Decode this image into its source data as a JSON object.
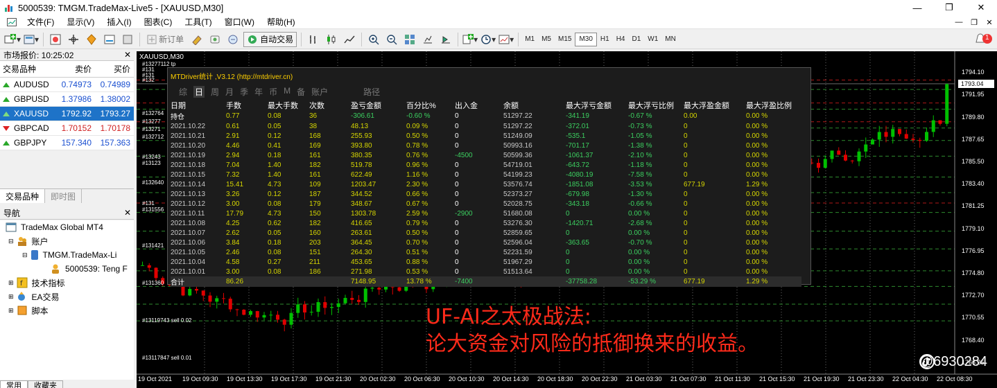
{
  "window": {
    "title": "5000539: TMGM.TradeMax-Live5 - [XAUUSD,M30]"
  },
  "menu": [
    "文件(F)",
    "显示(V)",
    "插入(I)",
    "图表(C)",
    "工具(T)",
    "窗口(W)",
    "帮助(H)"
  ],
  "toolbar": {
    "new_order": "新订单",
    "auto_trade": "自动交易",
    "timeframes": [
      "M1",
      "M5",
      "M15",
      "M30",
      "H1",
      "H4",
      "D1",
      "W1",
      "MN"
    ],
    "active_timeframe": "M30",
    "notification_count": "1"
  },
  "market_watch": {
    "title": "市场报价: 10:25:02",
    "headers": {
      "symbol": "交易品种",
      "bid": "卖价",
      "ask": "买价"
    },
    "rows": [
      {
        "symbol": "AUDUSD",
        "bid": "0.74973",
        "ask": "0.74989",
        "dir": "up",
        "color": "#1a4fd0"
      },
      {
        "symbol": "GBPUSD",
        "bid": "1.37986",
        "ask": "1.38002",
        "dir": "up",
        "color": "#1a4fd0"
      },
      {
        "symbol": "XAUUSD",
        "bid": "1792.92",
        "ask": "1793.27",
        "dir": "up",
        "selected": true
      },
      {
        "symbol": "GBPCAD",
        "bid": "1.70152",
        "ask": "1.70178",
        "dir": "down",
        "color": "#d02020"
      },
      {
        "symbol": "GBPJPY",
        "bid": "157.340",
        "ask": "157.363",
        "dir": "up",
        "color": "#1a4fd0"
      }
    ],
    "tabs": [
      "交易品种",
      "即时图"
    ]
  },
  "navigator": {
    "title": "导航",
    "items": {
      "root": "TradeMax Global MT4",
      "accounts": "账户",
      "server": "TMGM.TradeMax-Li",
      "account": "5000539: Teng F",
      "indicators": "技术指标",
      "ea": "EA交易",
      "scripts": "脚本"
    },
    "tabs": [
      "常用",
      "收藏夹"
    ]
  },
  "chart": {
    "symbol": "XAUUSD,M30",
    "order_labels": [
      "#13277112 tp",
      "#131",
      "#131",
      "#132",
      "#132764",
      "#13277",
      "#13271",
      "#132712",
      "#13243",
      "#13123",
      "#132640",
      "#131",
      "#131556",
      "#131421",
      "#131360",
      "#13119743 sell 0.02",
      "#13117847 sell 0.01"
    ],
    "price_axis": [
      "1794.10",
      "1791.95",
      "1789.80",
      "1787.65",
      "1785.50",
      "1783.40",
      "1781.25",
      "1779.10",
      "1776.95",
      "1774.80",
      "1772.70",
      "1770.55",
      "1768.40",
      "1766.25"
    ],
    "current_price": "1793.04",
    "time_axis": [
      "19 Oct 2021",
      "19 Oct 09:30",
      "19 Oct 13:30",
      "19 Oct 17:30",
      "19 Oct 21:30",
      "20 Oct 02:30",
      "20 Oct 06:30",
      "20 Oct 10:30",
      "20 Oct 14:30",
      "20 Oct 18:30",
      "20 Oct 22:30",
      "21 Oct 03:30",
      "21 Oct 07:30",
      "21 Oct 11:30",
      "21 Oct 15:30",
      "21 Oct 19:30",
      "21 Oct 23:30",
      "22 Oct 04:30",
      "22 Oct 08:30"
    ],
    "candle_colors": {
      "bull": "#00c000",
      "bear": "#e00000"
    }
  },
  "stats": {
    "title": "MTDriver统计 ,V3.12 (http://mtdriver.cn)",
    "tabs": [
      "综",
      "日",
      "周",
      "月",
      "季",
      "年",
      "币",
      "M",
      "备",
      "账户",
      "路径"
    ],
    "active_tab": "日",
    "headers": [
      "日期",
      "手数",
      "最大手数",
      "次数",
      "盈亏金额",
      "百分比%",
      "出入金",
      "余额",
      "最大浮亏金额",
      "最大浮亏比例",
      "最大浮盈金额",
      "最大浮盈比例"
    ],
    "rows": [
      [
        "持仓",
        "0.77",
        "0.08",
        "36",
        "-306.61",
        "-0.60 %",
        "0",
        "51297.22",
        "-341.19",
        "-0.67 %",
        "0.00",
        "0.00 %"
      ],
      [
        "2021.10.22",
        "0.61",
        "0.05",
        "38",
        "48.13",
        "0.09 %",
        "0",
        "51297.22",
        "-372.01",
        "-0.73 %",
        "0",
        "0.00 %"
      ],
      [
        "2021.10.21",
        "2.91",
        "0.12",
        "168",
        "255.93",
        "0.50 %",
        "0",
        "51249.09",
        "-535.1",
        "-1.05 %",
        "0",
        "0.00 %"
      ],
      [
        "2021.10.20",
        "4.46",
        "0.41",
        "169",
        "393.80",
        "0.78 %",
        "0",
        "50993.16",
        "-701.17",
        "-1.38 %",
        "0",
        "0.00 %"
      ],
      [
        "2021.10.19",
        "2.94",
        "0.18",
        "161",
        "380.35",
        "0.76 %",
        "-4500",
        "50599.36",
        "-1061.37",
        "-2.10 %",
        "0",
        "0.00 %"
      ],
      [
        "2021.10.18",
        "7.04",
        "1.40",
        "182",
        "519.78",
        "0.96 %",
        "0",
        "54719.01",
        "-643.72",
        "-1.18 %",
        "0",
        "0.00 %"
      ],
      [
        "2021.10.15",
        "7.32",
        "1.40",
        "161",
        "622.49",
        "1.16 %",
        "0",
        "54199.23",
        "-4080.19",
        "-7.58 %",
        "0",
        "0.00 %"
      ],
      [
        "2021.10.14",
        "15.41",
        "4.73",
        "109",
        "1203.47",
        "2.30 %",
        "0",
        "53576.74",
        "-1851.08",
        "-3.53 %",
        "677.19",
        "1.29 %"
      ],
      [
        "2021.10.13",
        "3.26",
        "0.12",
        "187",
        "344.52",
        "0.66 %",
        "0",
        "52373.27",
        "-679.98",
        "-1.30 %",
        "0",
        "0.00 %"
      ],
      [
        "2021.10.12",
        "3.00",
        "0.08",
        "179",
        "348.67",
        "0.67 %",
        "0",
        "52028.75",
        "-343.18",
        "-0.66 %",
        "0",
        "0.00 %"
      ],
      [
        "2021.10.11",
        "17.79",
        "4.73",
        "150",
        "1303.78",
        "2.59 %",
        "-2900",
        "51680.08",
        "0",
        "0.00 %",
        "0",
        "0.00 %"
      ],
      [
        "2021.10.08",
        "4.25",
        "0.62",
        "182",
        "416.65",
        "0.79 %",
        "0",
        "53276.30",
        "-1420.71",
        "-2.68 %",
        "0",
        "0.00 %"
      ],
      [
        "2021.10.07",
        "2.62",
        "0.05",
        "160",
        "263.61",
        "0.50 %",
        "0",
        "52859.65",
        "0",
        "0.00 %",
        "0",
        "0.00 %"
      ],
      [
        "2021.10.06",
        "3.84",
        "0.18",
        "203",
        "364.45",
        "0.70 %",
        "0",
        "52596.04",
        "-363.65",
        "-0.70 %",
        "0",
        "0.00 %"
      ],
      [
        "2021.10.05",
        "2.46",
        "0.08",
        "151",
        "264.30",
        "0.51 %",
        "0",
        "52231.59",
        "0",
        "0.00 %",
        "0",
        "0.00 %"
      ],
      [
        "2021.10.04",
        "4.58",
        "0.27",
        "211",
        "453.65",
        "0.88 %",
        "0",
        "51967.29",
        "0",
        "0.00 %",
        "0",
        "0.00 %"
      ],
      [
        "2021.10.01",
        "3.00",
        "0.08",
        "186",
        "271.98",
        "0.53 %",
        "0",
        "51513.64",
        "0",
        "0.00 %",
        "0",
        "0.00 %"
      ]
    ],
    "total": [
      "合计",
      "86.26",
      "",
      "",
      "7148.95",
      "13.78 %",
      "-7400",
      "",
      "-37758.28",
      "-53.29 %",
      "677.19",
      "1.29 %"
    ]
  },
  "annotation": {
    "line1": "UF-AI之太极战法:",
    "line2": "论大资金对风险的抵御换来的收益。"
  },
  "watermark": "@6930284"
}
